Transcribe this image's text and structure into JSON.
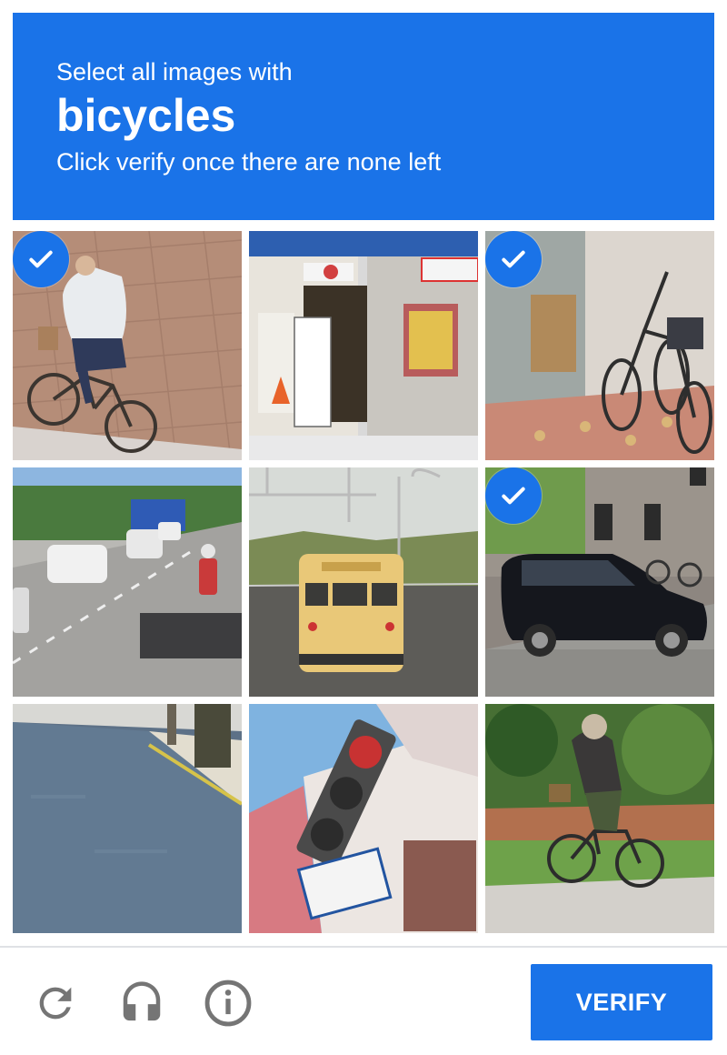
{
  "header": {
    "instruction": "Select all images with",
    "target": "bicycles",
    "hint": "Click verify once there are none left"
  },
  "grid": {
    "rows": 3,
    "columns": 3,
    "tiles": [
      {
        "index": 1,
        "content": "person riding bicycle on brick pavement",
        "selected": true
      },
      {
        "index": 2,
        "content": "shop front with signs and merchandise",
        "selected": false
      },
      {
        "index": 3,
        "content": "bicycles parked by storefront",
        "selected": true
      },
      {
        "index": 4,
        "content": "road with cars and motorcycle",
        "selected": false
      },
      {
        "index": 5,
        "content": "yellow school bus on road",
        "selected": false
      },
      {
        "index": 6,
        "content": "black minivan parked on street",
        "selected": true
      },
      {
        "index": 7,
        "content": "empty road with trees",
        "selected": false
      },
      {
        "index": 8,
        "content": "traffic lights and street sign",
        "selected": false
      },
      {
        "index": 9,
        "content": "person riding bicycle on sidewalk",
        "selected": false
      }
    ]
  },
  "footer": {
    "verify_label": "VERIFY",
    "icons": [
      "reload-icon",
      "headphones-icon",
      "info-icon"
    ]
  },
  "colors": {
    "accent": "#1a73e8",
    "check_bg": "#1a73e8",
    "icon_gray": "#757575",
    "divider": "#dfe1e5"
  }
}
